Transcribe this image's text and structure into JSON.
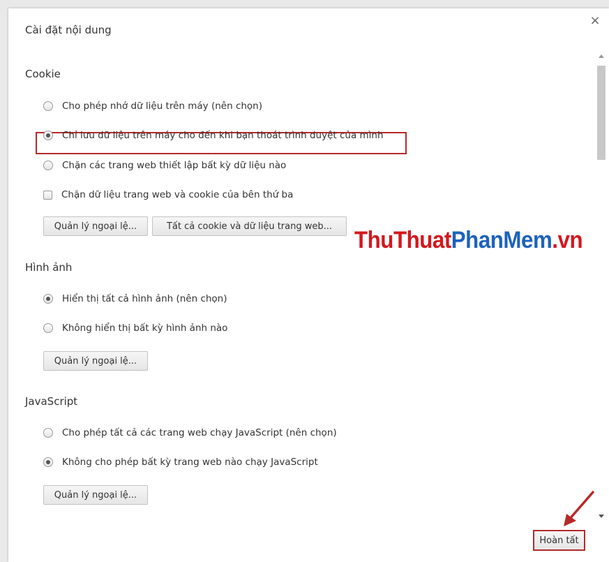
{
  "dialog": {
    "title": "Cài đặt nội dung",
    "close_icon": "×",
    "done_label": "Hoàn tất"
  },
  "cookie": {
    "title": "Cookie",
    "options": [
      "Cho phép nhớ dữ liệu trên máy (nên chọn)",
      "Chỉ lưu dữ liệu trên máy cho đến khi bạn thoát trình duyệt của mình",
      "Chặn các trang web thiết lập bất kỳ dữ liệu nào"
    ],
    "selected_option": 1,
    "block_third_party_label": "Chặn dữ liệu trang web và cookie của bên thứ ba",
    "block_third_party_checked": false,
    "manage_exceptions_label": "Quản lý ngoại lệ...",
    "all_cookies_label": "Tất cả cookie và dữ liệu trang web..."
  },
  "images": {
    "title": "Hình ảnh",
    "options": [
      "Hiển thị tất cả hình ảnh (nên chọn)",
      "Không hiển thị bất kỳ hình ảnh nào"
    ],
    "selected_option": 0,
    "manage_exceptions_label": "Quản lý ngoại lệ..."
  },
  "javascript": {
    "title": "JavaScript",
    "options": [
      "Cho phép tất cả các trang web chạy JavaScript (nên chọn)",
      "Không cho phép bất kỳ trang web nào chạy JavaScript"
    ],
    "selected_option": 1,
    "manage_exceptions_label": "Quản lý ngoại lệ..."
  },
  "watermark": {
    "part1": "ThuThuat",
    "part2": "PhanMem",
    "part3": ".vn"
  },
  "colors": {
    "highlight": "#b52a2a",
    "watermark_red": "#d3181e",
    "watermark_blue": "#1d62bd"
  }
}
